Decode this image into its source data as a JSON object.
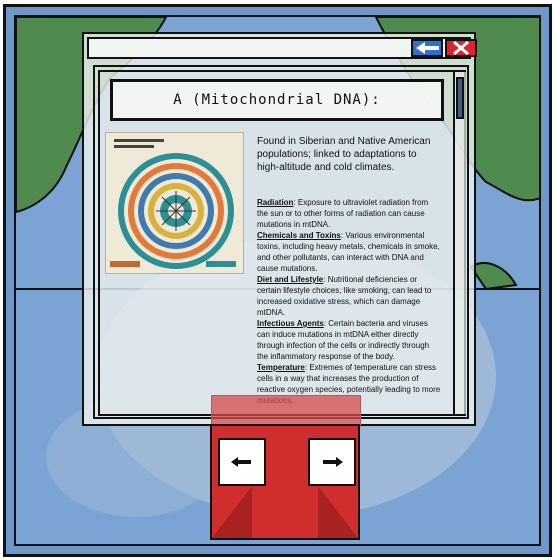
{
  "window": {
    "title": "A (Mitochondrial DNA):",
    "buttons": {
      "back_icon": "arrow-left-icon",
      "close_icon": "close-x-icon"
    }
  },
  "content": {
    "summary": "Found in Siberian and Native American populations; linked to adaptations to high-altitude and cold climates.",
    "factors": [
      {
        "term": "Radiation",
        "text": ": Exposure to ultraviolet radiation from the sun or to other forms of radiation can cause mutations in mtDNA."
      },
      {
        "term": "Chemicals and Toxins",
        "text": ": Various environmental toxins, including heavy metals, chemicals in smoke, and other pollutants, can interact with DNA and cause mutations."
      },
      {
        "term": "Diet and Lifestyle",
        "text": ": Nutritional deficiencies or certain lifestyle choices, like smoking, can lead to increased oxidative stress, which can damage mtDNA."
      },
      {
        "term": "Infectious Agents",
        "text": ": Certain bacteria and viruses can induce mutations in mtDNA either directly through infection of the cells or indirectly through the inflammatory response of the body."
      },
      {
        "term": "Temperature",
        "text": ": Extremes of temperature can stress cells in a way that increases the production of reactive oxygen species, potentially leading to more mutations."
      }
    ]
  },
  "nav": {
    "left_icon": "arrow-left-icon",
    "right_icon": "arrow-right-icon"
  },
  "colors": {
    "ocean": "#7ba3d3",
    "land": "#4f8a4f",
    "drawer_red": "#d02e2e",
    "back_blue": "#2f6fd0",
    "close_red": "#d9262e",
    "scroll_thumb": "#3e5f85"
  }
}
